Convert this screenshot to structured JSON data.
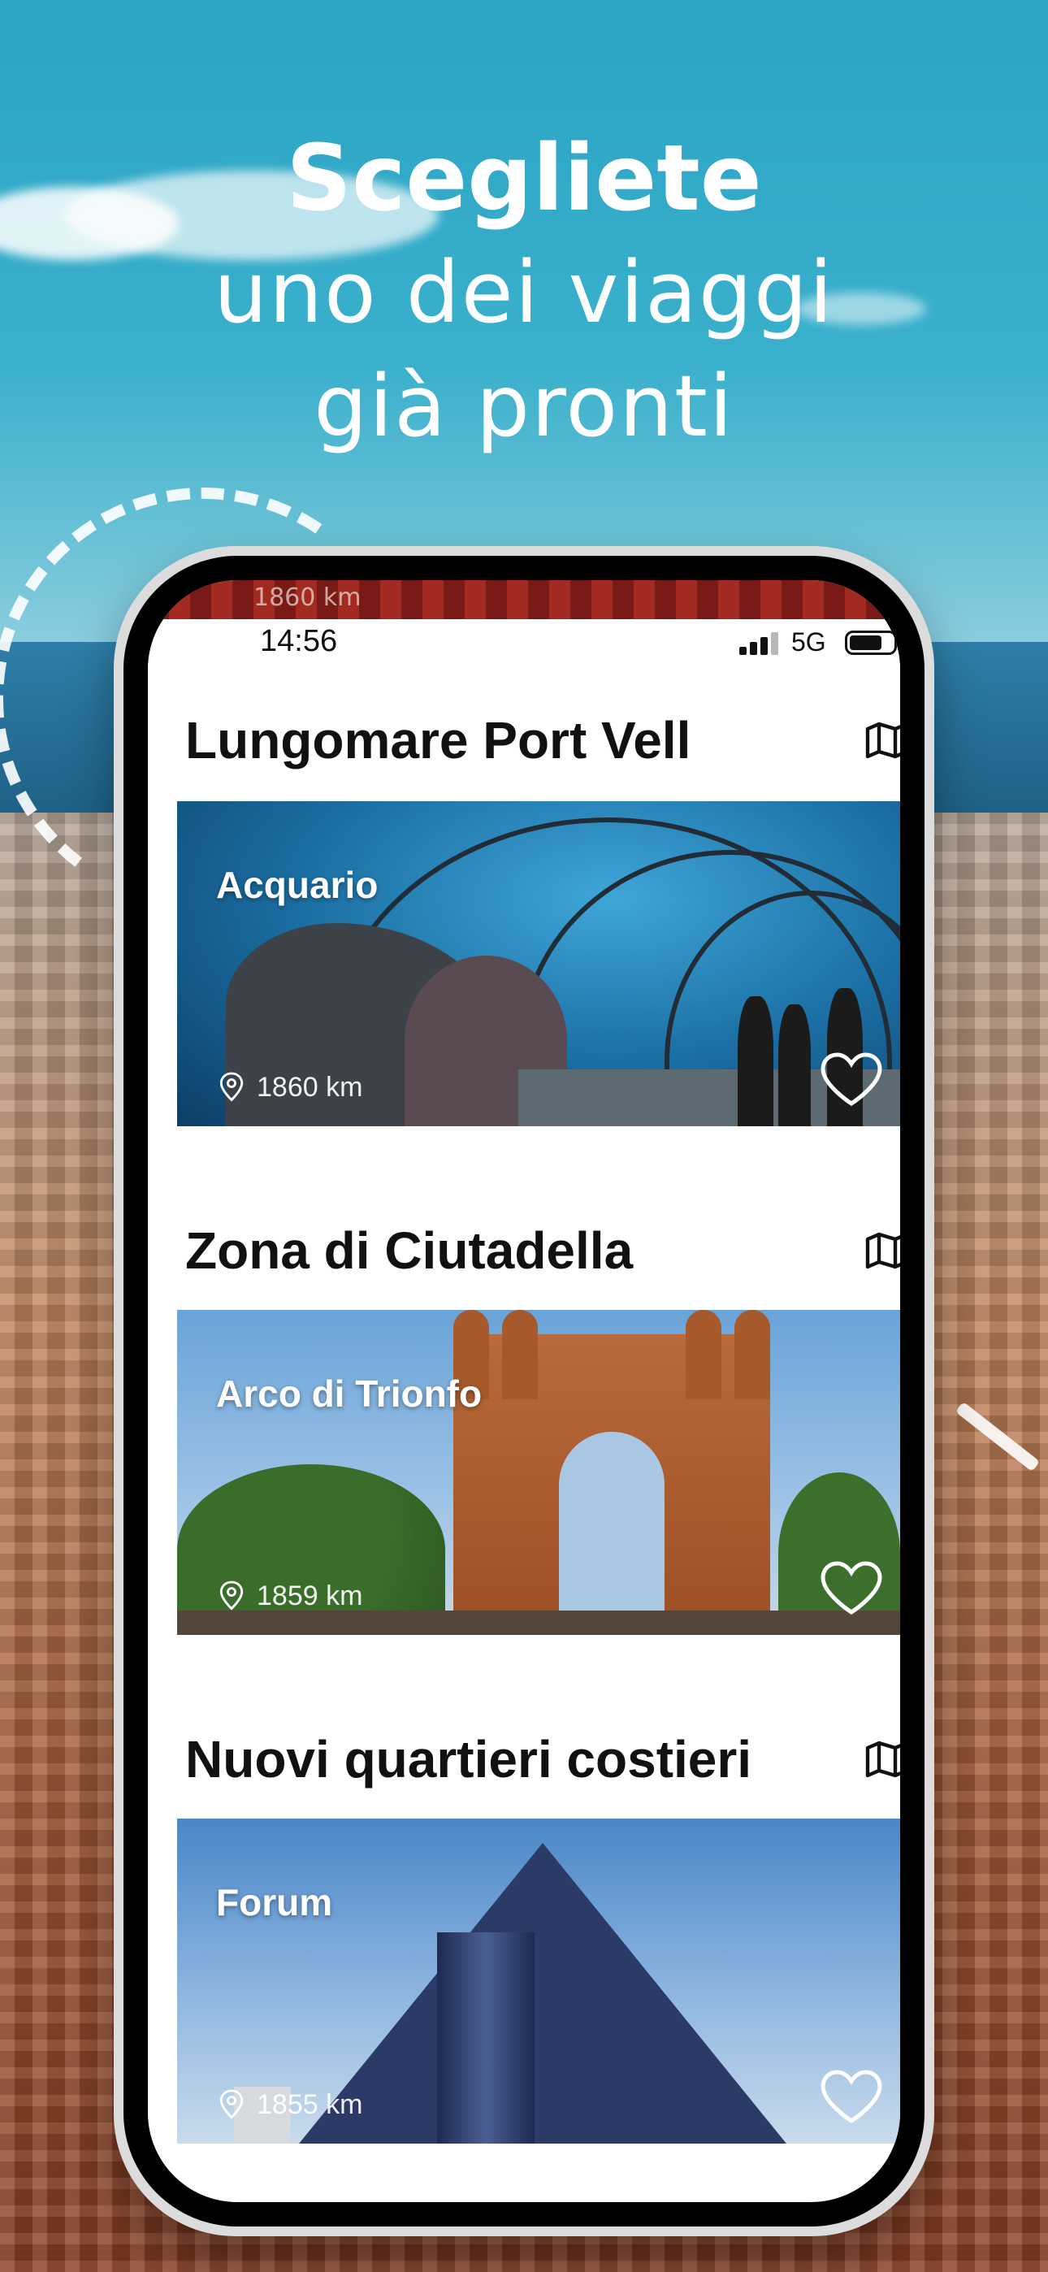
{
  "headline": {
    "line1": "Scegliete",
    "line2": "uno dei viaggi",
    "line3": "già pronti"
  },
  "phone": {
    "peek_text": "1860 km",
    "status": {
      "time": "14:56",
      "network": "5G"
    },
    "sections": [
      {
        "title": "Lungomare Port Vell",
        "card": {
          "label": "Acquario",
          "distance": "1860 km"
        }
      },
      {
        "title": "Zona di Ciutadella",
        "card": {
          "label": "Arco di Trionfo",
          "distance": "1859 km"
        }
      },
      {
        "title": "Nuovi quartieri costieri",
        "card": {
          "label": "Forum",
          "distance": "1855 km"
        }
      }
    ]
  },
  "icons": {
    "map": "map-icon",
    "pin": "location-pin-icon",
    "heart": "heart-outline-icon"
  },
  "colors": {
    "headline_text": "#ffffff",
    "title_text": "#111111",
    "card_overlay_text": "#ffffff"
  }
}
